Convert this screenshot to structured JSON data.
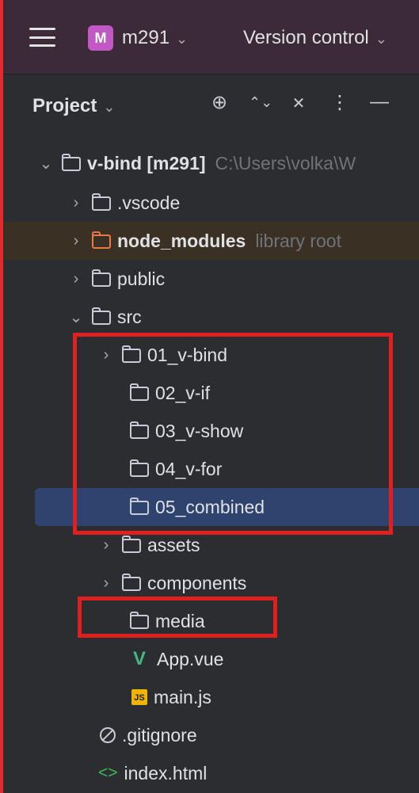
{
  "topbar": {
    "menu_icon": "hamburger-menu-icon",
    "project_badge": "M",
    "project_name": "m291",
    "vcs_label": "Version control",
    "chevron": "⌄"
  },
  "panel": {
    "title": "Project",
    "chevron": "⌄",
    "tools": [
      {
        "icon": "locate-icon",
        "glyph": "⊕"
      },
      {
        "icon": "expand-all-icon",
        "glyph": "⌃⌄"
      },
      {
        "icon": "collapse-all-icon",
        "glyph": "✕"
      },
      {
        "icon": "more-options-icon",
        "glyph": "⋮"
      },
      {
        "icon": "hide-icon",
        "glyph": "—"
      }
    ]
  },
  "tree": [
    {
      "label": "v-bind [m291]",
      "suffix": "C:\\Users\\volka\\W",
      "expanded": true,
      "icon": "folder-icon"
    },
    {
      "label": ".vscode",
      "expanded": false,
      "icon": "folder-icon"
    },
    {
      "label": "node_modules",
      "suffix": "library root",
      "expanded": false,
      "icon": "folder-icon"
    },
    {
      "label": "public",
      "expanded": false,
      "icon": "folder-icon"
    },
    {
      "label": "src",
      "expanded": true,
      "icon": "folder-icon"
    },
    {
      "label": "01_v-bind",
      "expanded": false,
      "icon": "folder-icon"
    },
    {
      "label": "02_v-if",
      "icon": "folder-icon"
    },
    {
      "label": "03_v-show",
      "icon": "folder-icon"
    },
    {
      "label": "04_v-for",
      "icon": "folder-icon"
    },
    {
      "label": "05_combined",
      "icon": "folder-icon",
      "selected": true
    },
    {
      "label": "assets",
      "expanded": false,
      "icon": "folder-icon"
    },
    {
      "label": "components",
      "expanded": false,
      "icon": "folder-icon"
    },
    {
      "label": "media",
      "icon": "folder-icon"
    },
    {
      "label": "App.vue",
      "icon": "vue-file-icon"
    },
    {
      "label": "main.js",
      "icon": "js-file-icon",
      "badge": "JS"
    },
    {
      "label": ".gitignore",
      "icon": "gitignore-icon"
    },
    {
      "label": "index.html",
      "icon": "html-file-icon",
      "glyph": "<>"
    }
  ],
  "colors": {
    "accent_red": "#E02020",
    "selection": "#2E436E",
    "library_root_bg": "#3A3024",
    "folder_orange": "#E8784A",
    "vue_green": "#41B883"
  }
}
